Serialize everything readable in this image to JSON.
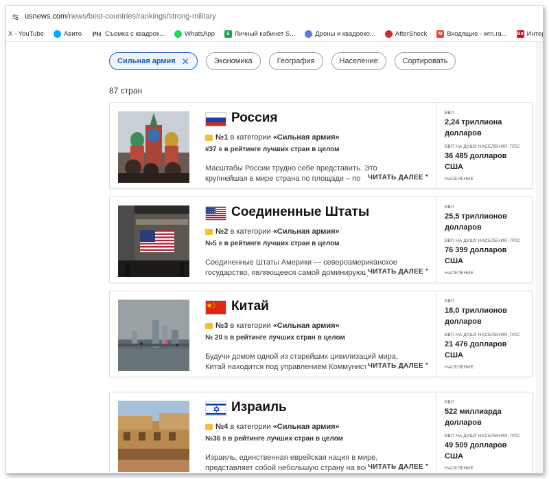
{
  "browser": {
    "url_host": "usnews.com",
    "url_path": "/news/best-countries/rankings/strong-military"
  },
  "bookmarks": [
    {
      "label": "X - YouTube",
      "icon": "youtube-icon",
      "color": "#ff0000",
      "glyph": ""
    },
    {
      "label": "Авито",
      "icon": "avito-icon",
      "color": "#00aaff",
      "glyph": ""
    },
    {
      "label": "Съемка с квадрок...",
      "icon": "ph-icon",
      "color": "#333333",
      "glyph": "PH"
    },
    {
      "label": "WhatsApp",
      "icon": "whatsapp-icon",
      "color": "#25d366",
      "glyph": ""
    },
    {
      "label": "Личный кабинет S...",
      "icon": "s-icon",
      "color": "#1fa34a",
      "glyph": "S"
    },
    {
      "label": "Дроны и квадроко...",
      "icon": "drone-icon",
      "color": "#5b7bd5",
      "glyph": ""
    },
    {
      "label": "AfterShock",
      "icon": "aftershock-icon",
      "color": "#d62b2b",
      "glyph": ""
    },
    {
      "label": "Входящие - wm.ra...",
      "icon": "gmail-icon",
      "color": "#ea4335",
      "glyph": "M"
    },
    {
      "label": "Интернет-магазин...",
      "icon": "store-icon",
      "color": "#c4161c",
      "glyph": "Вп"
    }
  ],
  "filters": {
    "chips": [
      {
        "label": "Сильная армия",
        "active": true
      },
      {
        "label": "Экономика",
        "active": false
      },
      {
        "label": "География",
        "active": false
      },
      {
        "label": "Население",
        "active": false
      },
      {
        "label": "Сортировать",
        "active": false
      }
    ]
  },
  "results_count": "87 стран",
  "labels": {
    "category_prefix": "в категории",
    "category_name": "«Сильная армия»",
    "overall_suffix": "в рейтинге лучших стран в целом",
    "read_more": "ЧИТАТЬ ДАЛЕЕ \"",
    "gdp": "ВВП",
    "gdp_per_capita": "ВВП НА ДУШУ НАСЕЛЕНИЯ, ППС",
    "population": "НАСЕЛЕНИЕ"
  },
  "countries": [
    {
      "name": "Россия",
      "rank": "№1",
      "overall_rank": "#37",
      "description_1": "Масштабы России трудно себе представить. Это",
      "description_2": "крупнейшая в мире страна по площади – по",
      "gdp": "2,24 триллиона долларов",
      "gdp_per_capita": "36 485 долларов США"
    },
    {
      "name": "Соединенные Штаты",
      "rank": "№2",
      "overall_rank": "№5",
      "description_1": "Соединенные Штаты Америки — североамериканское",
      "description_2": "государство, являющееся самой доминирующей",
      "gdp": "25,5 триллионов долларов",
      "gdp_per_capita": "76 399 долларов США"
    },
    {
      "name": "Китай",
      "rank": "№3",
      "overall_rank": "№ 20",
      "description_1": "Будучи домом одной из старейших цивилизаций мира,",
      "description_2": "Китай находится под управлением Коммунистической",
      "gdp": "18,0 триллионов долларов",
      "gdp_per_capita": "21 476 долларов США"
    },
    {
      "name": "Израиль",
      "rank": "№4",
      "overall_rank": "№36",
      "description_1": "Израиль, единственная еврейская нация в мире,",
      "description_2": "представляет собой небольшую страну на востоке",
      "gdp": "522 миллиарда долларов",
      "gdp_per_capita": "49 509 долларов США"
    }
  ]
}
